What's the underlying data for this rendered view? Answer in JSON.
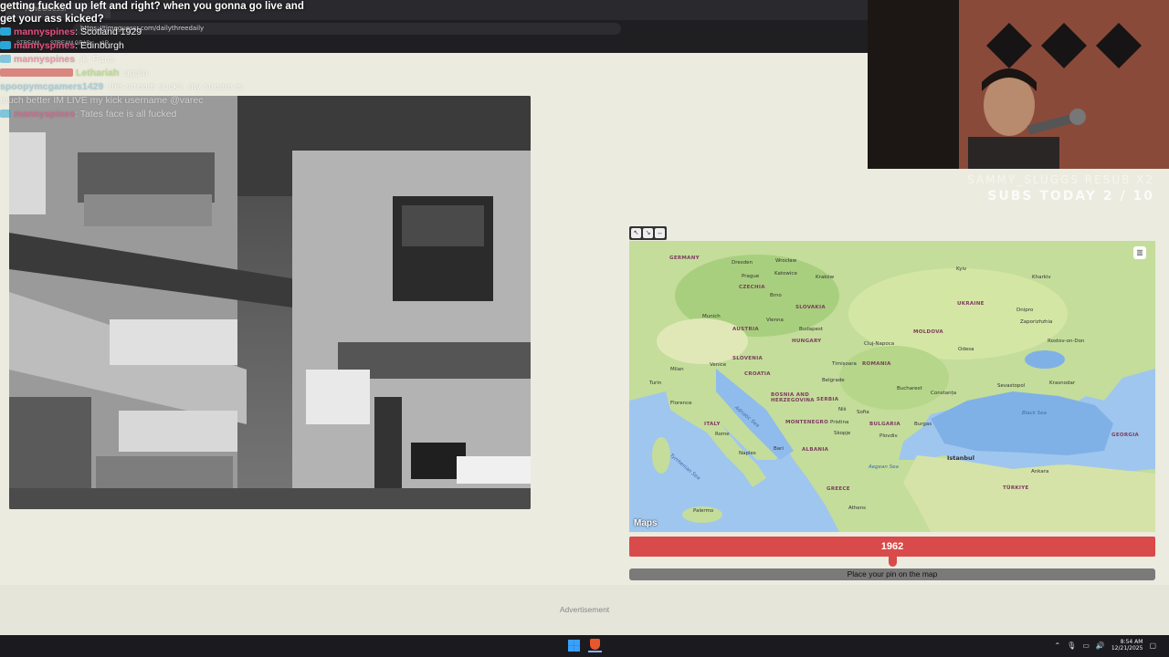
{
  "browser": {
    "tab_title": "TimeGuessr",
    "url": "https://timeguessr.com/dailythreedaily",
    "bookmarks": [
      "STREAM",
      "STREAM GRAB",
      "AR"
    ]
  },
  "chat": {
    "top_message": "getting fucked up left and right? when you gonna go live and get your ass kicked?",
    "lines": [
      {
        "user": "mannyspines",
        "message": "Scotland 1929"
      },
      {
        "user": "mannyspines",
        "message": "Edinburgh"
      },
      {
        "user": "mannyspines",
        "message": "jk. Paris"
      },
      {
        "user": "Lethariah",
        "message": "again"
      },
      {
        "user": "spoopymcgamers1429",
        "message": "this stream sucks. my stream is"
      },
      {
        "user": "",
        "message": "much better IM LIVE my kick username @varec"
      },
      {
        "user": "mannyspines",
        "message": "Tates face is all fucked"
      }
    ]
  },
  "stream_overlay": {
    "resub": "SAMMY_SLUGGS RESUB X2",
    "subs_today": "SUBS TODAY 2 / 10"
  },
  "map": {
    "tools": [
      "↖",
      "↘",
      "↔"
    ],
    "layers_icon": "layers-icon",
    "maps_brand": "Maps",
    "countries": [
      {
        "name": "GERMANY"
      },
      {
        "name": "CZECHIA"
      },
      {
        "name": "SLOVAKIA"
      },
      {
        "name": "AUSTRIA"
      },
      {
        "name": "HUNGARY"
      },
      {
        "name": "SLOVENIA"
      },
      {
        "name": "CROATIA"
      },
      {
        "name": "ROMANIA"
      },
      {
        "name": "MOLDOVA"
      },
      {
        "name": "UKRAINE"
      },
      {
        "name": "BOSNIA AND HERZEGOVINA"
      },
      {
        "name": "SERBIA"
      },
      {
        "name": "MONTENEGRO"
      },
      {
        "name": "BULGARIA"
      },
      {
        "name": "ITALY"
      },
      {
        "name": "ALBANIA"
      },
      {
        "name": "GREECE"
      },
      {
        "name": "TÜRKIYE"
      },
      {
        "name": "GEORGIA"
      }
    ],
    "cities": [
      "Dresden",
      "Wrocław",
      "Prague",
      "Katowice",
      "Kraków",
      "Kyiv",
      "Kharkiv",
      "Brno",
      "Vienna",
      "Munich",
      "Budapest",
      "Dnipro",
      "Zaporizhzhia",
      "Cluj-Napoca",
      "Milan",
      "Venice",
      "Turin",
      "Timișoara",
      "Odesa",
      "Rostov-on-Don",
      "Belgrade",
      "Bucharest",
      "Constanța",
      "Sevastopol",
      "Krasnodar",
      "Florence",
      "Niš",
      "Sofia",
      "Rome",
      "Pristina",
      "Skopje",
      "Plovdiv",
      "Burgas",
      "Naples",
      "Bari",
      "Istanbul",
      "Athens",
      "Palermo",
      "Ankara"
    ],
    "seas": [
      "Black Sea",
      "Adriatic Sea",
      "Tyrrhenian Sea",
      "Aegean Sea"
    ]
  },
  "game": {
    "year": "1962",
    "year_fraction": 0.5,
    "place_pin_label": "Place your pin on the map"
  },
  "ad": {
    "label": "Advertisement"
  },
  "taskbar": {
    "time": "8:54 AM",
    "date": "12/21/2025"
  },
  "colors": {
    "year_bar": "#d94a4a",
    "chat_user": "#e94f7d",
    "page_bg": "#ebebdf"
  }
}
